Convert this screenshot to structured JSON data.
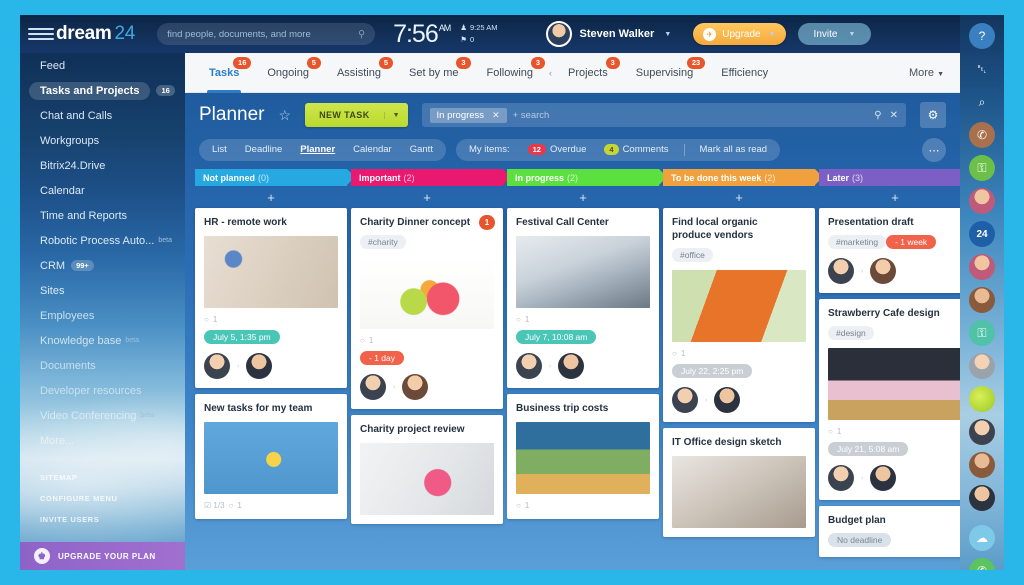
{
  "header": {
    "menu_icon": "hamburger-icon",
    "logo_text": "dream",
    "logo_suffix": "24",
    "search_placeholder": "find people, documents, and more",
    "search_icon": "search-icon",
    "clock_time": "7:56",
    "clock_meridiem": "AM",
    "status_time": "9:25 AM",
    "status_time_icon": "person-icon",
    "flag_count": "0",
    "flag_icon": "flag-icon",
    "user_name": "Steven Walker",
    "user_caret_icon": "chevron-down-icon",
    "avatar": "user-avatar",
    "upgrade_label": "Upgrade",
    "upgrade_icon": "rocket-icon",
    "invite_label": "Invite",
    "help_icon": "question-icon"
  },
  "sidebar": {
    "items": [
      {
        "label": "Feed",
        "count": "",
        "note": "",
        "state": ""
      },
      {
        "label": "Tasks and Projects",
        "count": "16",
        "note": "",
        "state": "active"
      },
      {
        "label": "Chat and Calls",
        "count": "",
        "note": "",
        "state": ""
      },
      {
        "label": "Workgroups",
        "count": "",
        "note": "",
        "state": ""
      },
      {
        "label": "Bitrix24.Drive",
        "count": "",
        "note": "",
        "state": ""
      },
      {
        "label": "Calendar",
        "count": "",
        "note": "",
        "state": ""
      },
      {
        "label": "Time and Reports",
        "count": "",
        "note": "",
        "state": ""
      },
      {
        "label": "Robotic Process Auto...",
        "count": "",
        "note": "beta",
        "state": ""
      },
      {
        "label": "CRM",
        "count": "99+",
        "note": "",
        "state": ""
      },
      {
        "label": "Sites",
        "count": "",
        "note": "",
        "state": ""
      },
      {
        "label": "Employees",
        "count": "",
        "note": "",
        "state": "dim"
      },
      {
        "label": "Knowledge base",
        "count": "",
        "note": "beta",
        "state": "dim"
      },
      {
        "label": "Documents",
        "count": "",
        "note": "",
        "state": "dim2"
      },
      {
        "label": "Developer resources",
        "count": "",
        "note": "",
        "state": "dim3"
      },
      {
        "label": "Video Conferencing",
        "count": "",
        "note": "beta",
        "state": "dim3"
      },
      {
        "label": "More...",
        "count": "",
        "note": "",
        "state": "dim3"
      }
    ],
    "footer_links": [
      "SITEMAP",
      "CONFIGURE MENU",
      "INVITE USERS"
    ],
    "upgrade_plan_label": "UPGRADE YOUR PLAN",
    "upgrade_plan_icon": "crown-icon"
  },
  "tabs": {
    "items": [
      {
        "label": "Tasks",
        "badge": "16",
        "active": true
      },
      {
        "label": "Ongoing",
        "badge": "5",
        "active": false
      },
      {
        "label": "Assisting",
        "badge": "5",
        "active": false
      },
      {
        "label": "Set by me",
        "badge": "3",
        "active": false
      },
      {
        "label": "Following",
        "badge": "3",
        "active": false
      },
      {
        "label": "Projects",
        "badge": "3",
        "active": false
      },
      {
        "label": "Supervising",
        "badge": "23",
        "active": false
      },
      {
        "label": "Efficiency",
        "badge": "",
        "active": false
      }
    ],
    "collapse_icon": "chevron-left-icon",
    "more_label": "More",
    "more_caret_icon": "chevron-down-icon"
  },
  "toolbar": {
    "page_title": "Planner",
    "star_icon": "star-icon",
    "new_task_label": "NEW TASK",
    "new_task_caret_icon": "chevron-down-icon",
    "filter_chip": "In progress",
    "filter_chip_remove_icon": "close-icon",
    "filter_search_placeholder": "+ search",
    "filter_search_icon": "search-icon",
    "filter_clear_icon": "close-icon",
    "settings_icon": "gear-icon"
  },
  "views": {
    "items": [
      "List",
      "Deadline",
      "Planner",
      "Calendar",
      "Gantt"
    ],
    "selected": "Planner",
    "my_items_label": "My items:",
    "overdue_count": "12",
    "overdue_label": "Overdue",
    "comments_count": "4",
    "comments_label": "Comments",
    "mark_all_label": "Mark all as read",
    "more_menu_icon": "ellipsis-icon"
  },
  "board": {
    "add_icon": "plus-icon",
    "columns": [
      {
        "title": "Not planned",
        "count": "(0)",
        "color": "#25a9e0",
        "cards": [
          {
            "title": "HR - remote work",
            "badge": "",
            "tag": "",
            "image": "img-hr",
            "comment_icon": "comment-icon",
            "comment_count": "1",
            "date": "July 5, 1:35 pm",
            "date_style": "d-green",
            "extra_meta": "",
            "people": [
              "pw4",
              "pw5"
            ],
            "arrow_icon": "arrow-right-icon"
          },
          {
            "title": "New tasks for my team",
            "badge": "",
            "tag": "",
            "image": "img-cup",
            "comment_icon": "comment-icon",
            "comment_count": "1",
            "date": "",
            "date_style": "",
            "extra_meta": "1/3",
            "people": [],
            "arrow_icon": "arrow-right-icon"
          }
        ]
      },
      {
        "title": "Important",
        "count": "(2)",
        "color": "#e8196f",
        "cards": [
          {
            "title": "Charity Dinner concept",
            "badge": "1",
            "tag": "#charity",
            "image": "img-fruit",
            "comment_icon": "comment-icon",
            "comment_count": "1",
            "date": "- 1 day",
            "date_style": "d-red",
            "extra_meta": "",
            "people": [
              "pw4",
              "pw"
            ],
            "arrow_icon": "arrow-right-icon"
          },
          {
            "title": "Charity project review",
            "badge": "",
            "tag": "",
            "image": "img-heart",
            "comment_icon": "comment-icon",
            "comment_count": "",
            "date": "",
            "date_style": "",
            "extra_meta": "",
            "people": [],
            "arrow_icon": "arrow-right-icon"
          }
        ]
      },
      {
        "title": "In progress",
        "count": "(2)",
        "color": "#5ce040",
        "cards": [
          {
            "title": "Festival Call Center",
            "badge": "",
            "tag": "",
            "image": "img-call",
            "comment_icon": "comment-icon",
            "comment_count": "1",
            "date": "July 7, 10:08 am",
            "date_style": "d-green",
            "extra_meta": "",
            "people": [
              "pw4",
              "pw5"
            ],
            "arrow_icon": "arrow-right-icon"
          },
          {
            "title": "Business trip costs",
            "badge": "",
            "tag": "",
            "image": "img-land",
            "comment_icon": "comment-icon",
            "comment_count": "1",
            "date": "",
            "date_style": "",
            "extra_meta": "",
            "people": [],
            "arrow_icon": "arrow-right-icon"
          }
        ]
      },
      {
        "title": "To be done this week",
        "count": "(2)",
        "color": "#f0a03c",
        "cards": [
          {
            "title": "Find local organic produce vendors",
            "badge": "",
            "tag": "#office",
            "image": "img-groc",
            "comment_icon": "comment-icon",
            "comment_count": "1",
            "date": "July 22, 2:25 pm",
            "date_style": "d-gray",
            "extra_meta": "",
            "people": [
              "pw4",
              "pw5"
            ],
            "arrow_icon": "arrow-right-icon"
          },
          {
            "title": "IT Office design sketch",
            "badge": "",
            "tag": "",
            "image": "img-team",
            "comment_icon": "comment-icon",
            "comment_count": "",
            "date": "",
            "date_style": "",
            "extra_meta": "",
            "people": [],
            "arrow_icon": "arrow-right-icon"
          }
        ]
      },
      {
        "title": "Later",
        "count": "(3)",
        "color": "#7b5fc4",
        "cards": [
          {
            "title": "Presentation draft",
            "badge": "",
            "tag": "#marketing",
            "image": "",
            "comment_icon": "",
            "comment_count": "",
            "date": "- 1 week",
            "date_style": "d-red",
            "extra_meta": "",
            "people": [
              "pw4",
              "pw"
            ],
            "arrow_icon": "arrow-right-icon"
          },
          {
            "title": "Strawberry Cafe design",
            "badge": "",
            "tag": "#design",
            "image": "img-cafe",
            "comment_icon": "comment-icon",
            "comment_count": "1",
            "date": "July 21, 5:08 am",
            "date_style": "d-gray",
            "extra_meta": "",
            "people": [
              "pw4",
              "pw5"
            ],
            "arrow_icon": "arrow-right-icon"
          },
          {
            "title": "Budget plan",
            "badge": "",
            "tag": "",
            "image": "",
            "comment_icon": "",
            "comment_count": "",
            "date": "No deadline",
            "date_style": "d-bluew",
            "extra_meta": "",
            "people": [],
            "arrow_icon": "arrow-right-icon"
          }
        ]
      }
    ]
  },
  "right_rail": {
    "items": [
      {
        "name": "help-icon",
        "glyph": "?",
        "style": "blue"
      },
      {
        "name": "notifications-bell-icon",
        "glyph": "␇",
        "style": "ghost"
      },
      {
        "name": "search-icon",
        "glyph": "⌕",
        "style": "ghost"
      },
      {
        "name": "call-icon",
        "glyph": "✆",
        "style": "brown"
      },
      {
        "name": "lock-icon",
        "glyph": "⚿",
        "style": "green"
      },
      {
        "name": "contact-avatar",
        "glyph": "",
        "style": "pw2"
      },
      {
        "name": "bitrix24-icon",
        "glyph": "24",
        "style": "b24"
      },
      {
        "name": "contact-avatar",
        "glyph": "",
        "style": "pw2"
      },
      {
        "name": "contact-avatar",
        "glyph": "",
        "style": "pw3"
      },
      {
        "name": "lock-icon",
        "glyph": "⚿",
        "style": "teal"
      },
      {
        "name": "contact-avatar",
        "glyph": "",
        "style": "pw6"
      },
      {
        "name": "lime-avatar",
        "glyph": "",
        "style": "lime"
      },
      {
        "name": "contact-avatar",
        "glyph": "",
        "style": "pw4"
      },
      {
        "name": "contact-avatar",
        "glyph": "",
        "style": "pw3"
      },
      {
        "name": "contact-avatar",
        "glyph": "",
        "style": "pw5"
      },
      {
        "name": "separator",
        "glyph": "",
        "style": "sep"
      },
      {
        "name": "weather-widget-icon",
        "glyph": "☁",
        "style": "icyan"
      },
      {
        "name": "call-button-icon",
        "glyph": "✆",
        "style": "gcall"
      }
    ]
  }
}
